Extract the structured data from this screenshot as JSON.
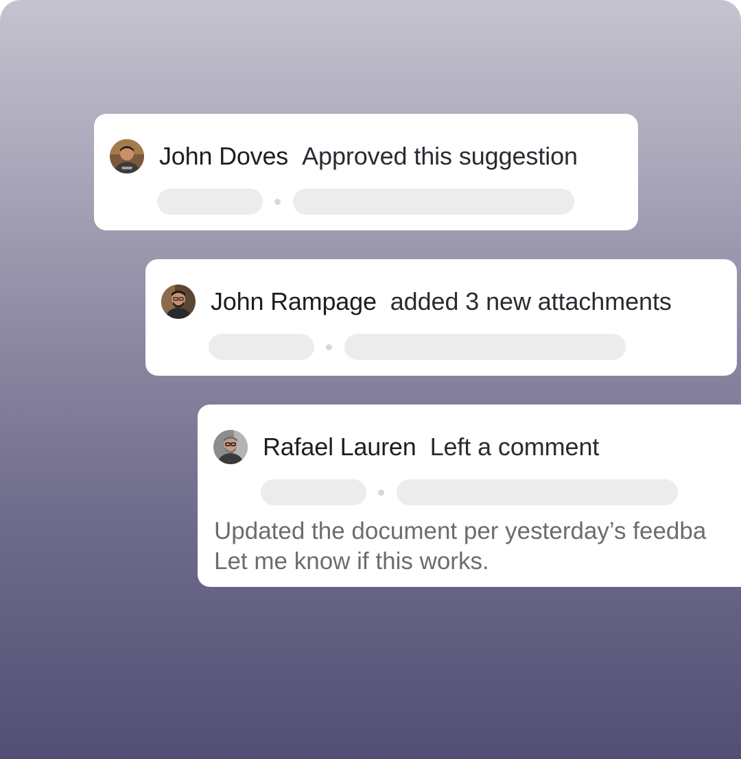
{
  "activity": [
    {
      "user": "John Doves",
      "action": "Approved this suggestion",
      "avatar": "john-doves-avatar"
    },
    {
      "user": "John Rampage",
      "action": "added 3 new attachments",
      "avatar": "john-rampage-avatar"
    },
    {
      "user": "Rafael Lauren",
      "action": "Left a comment",
      "avatar": "rafael-lauren-avatar",
      "comment": "Updated the document per yesterday’s feedba\nLet me know if this works."
    }
  ],
  "colors": {
    "background_top": "#c4c3cf",
    "background_bottom": "#524f74",
    "card": "#ffffff",
    "placeholder": "#ececec",
    "text_primary": "#1e1d24",
    "text_secondary": "#6c6c6c"
  }
}
